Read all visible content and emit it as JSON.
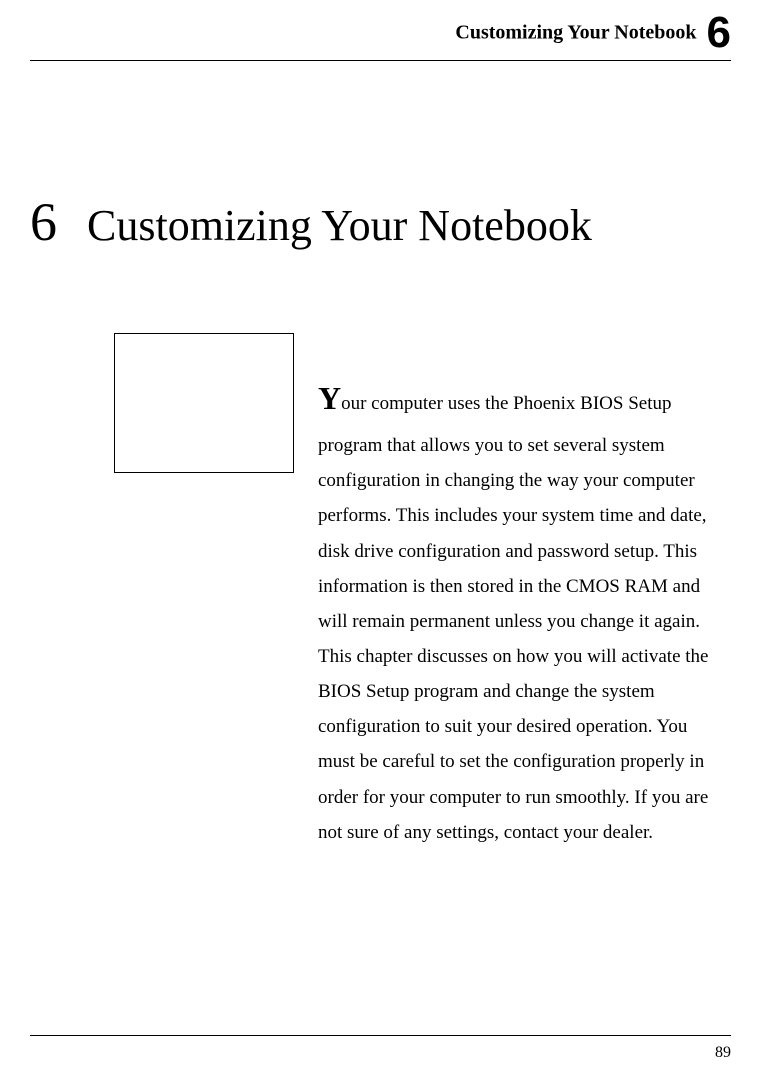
{
  "header": {
    "running_title": "Customizing Your Notebook",
    "chapter_number": "6"
  },
  "chapter": {
    "number": "6",
    "title": "Customizing Your Notebook"
  },
  "body": {
    "dropcap": "Y",
    "text": "our computer uses the Phoenix BIOS Setup program that allows you to set several system configuration in changing the way your computer performs. This includes your system time and date, disk drive configuration and password setup. This information is then stored in the CMOS RAM and will remain permanent unless you change it again. This chapter discusses on how you will activate the BIOS Setup program and change the system configuration to suit your desired operation. You must be careful to set the configuration properly in order for your computer to run smoothly. If you are not sure of any settings, contact your dealer."
  },
  "footer": {
    "page_number": "89"
  }
}
